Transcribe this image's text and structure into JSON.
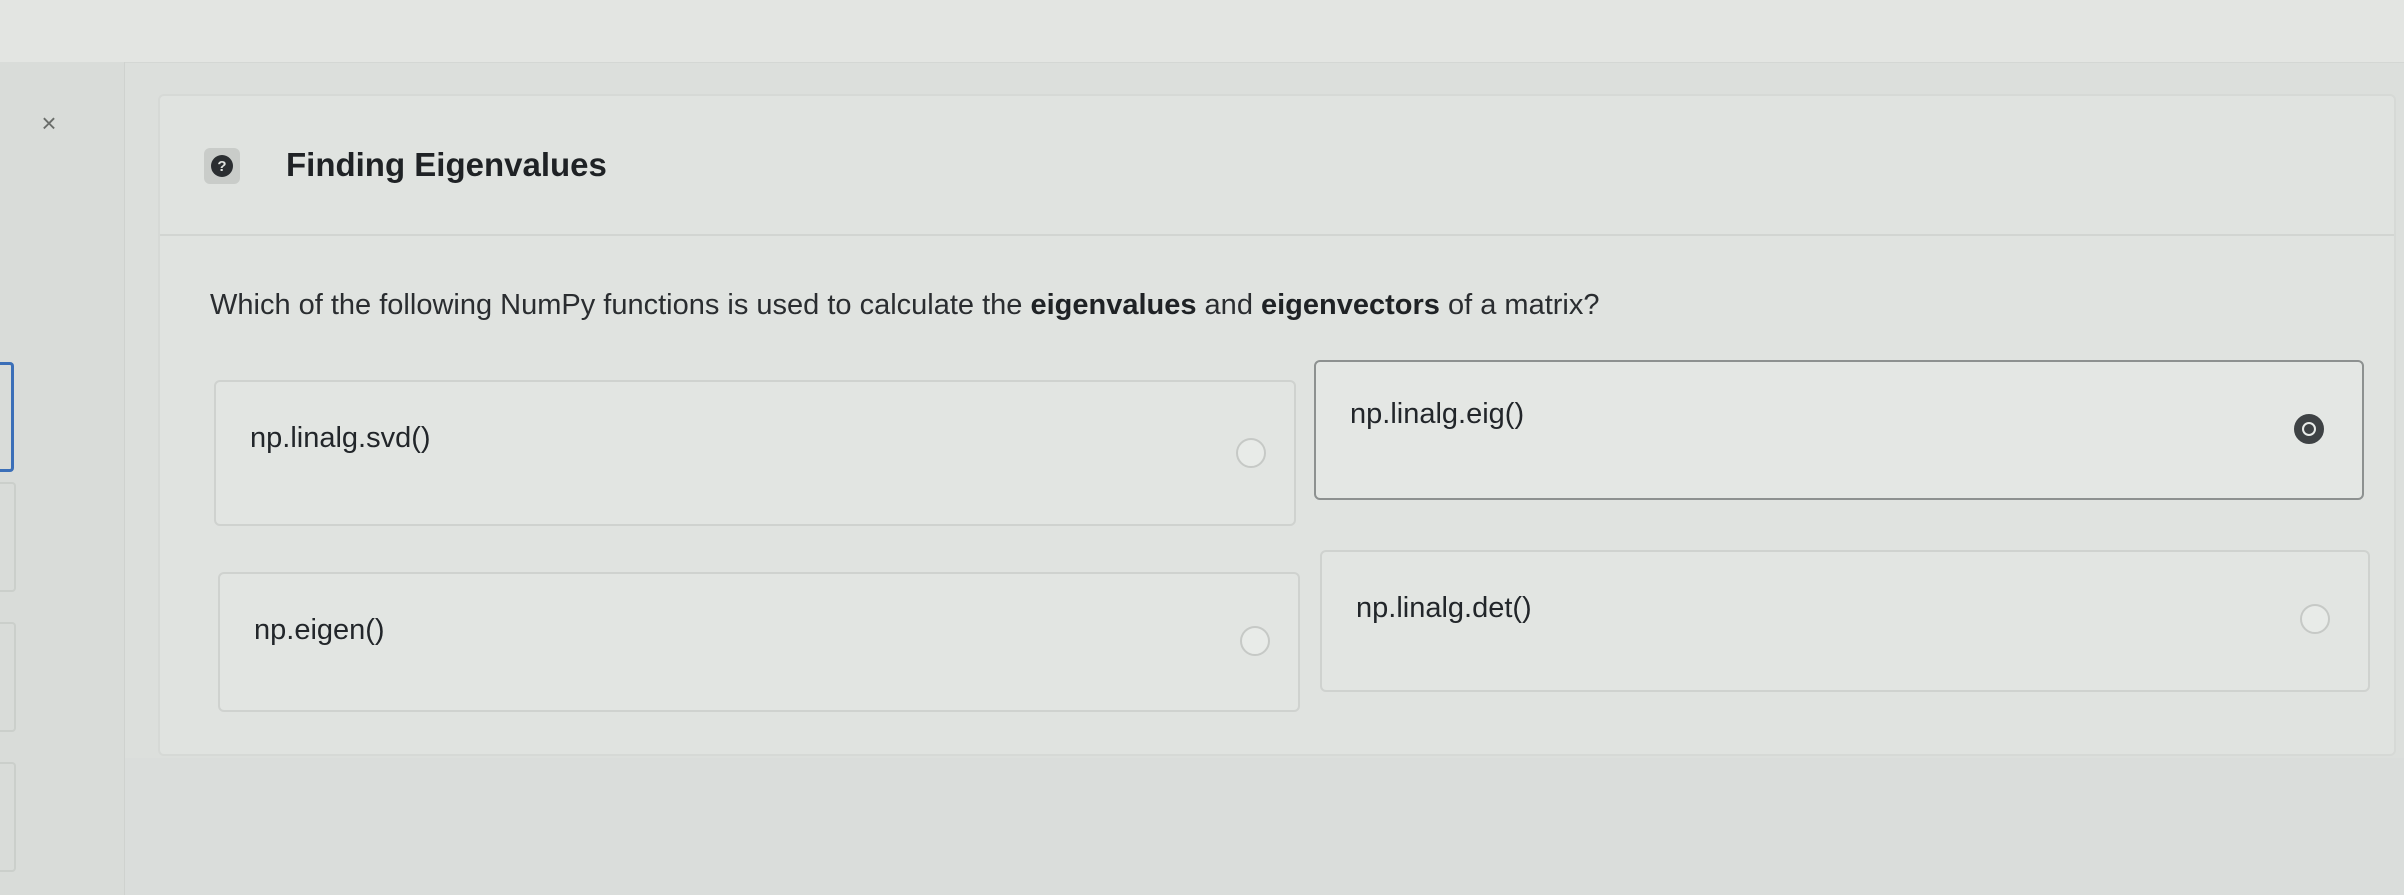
{
  "window": {
    "close_glyph": "×"
  },
  "question": {
    "title": "Finding Eigenvalues",
    "help_icon": "question-circle-icon",
    "prompt_parts": [
      "Which of the following NumPy functions is used to calculate the ",
      "eigenvalues",
      " and ",
      "eigenvectors",
      " of a matrix?"
    ],
    "options": [
      {
        "label": "np.linalg.svd()",
        "selected": false
      },
      {
        "label": "np.linalg.eig()",
        "selected": true
      },
      {
        "label": "np.eigen()",
        "selected": false
      },
      {
        "label": "np.linalg.det()",
        "selected": false
      }
    ]
  },
  "colors": {
    "accent": "#3b6fb8",
    "selected_radio": "#3e4244"
  }
}
